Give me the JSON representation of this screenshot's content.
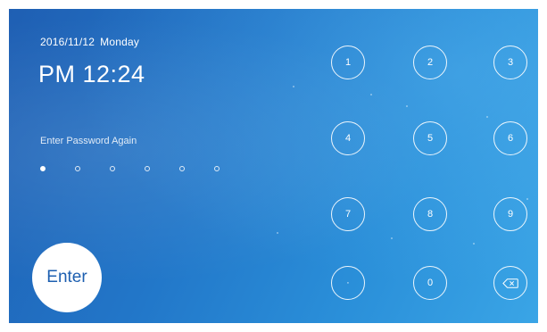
{
  "header": {
    "date": "2016/11/12",
    "weekday": "Monday",
    "time": "PM 12:24"
  },
  "password": {
    "prompt": "Enter Password Again",
    "length": 6,
    "entered": 1
  },
  "actions": {
    "enter_label": "Enter"
  },
  "keypad": {
    "keys": [
      "1",
      "2",
      "3",
      "4",
      "5",
      "6",
      "7",
      "8",
      "9",
      "·",
      "0"
    ],
    "backspace_icon": "backspace-icon"
  },
  "colors": {
    "background_start": "#1f5fb3",
    "background_end": "#3aa5e6",
    "enter_text": "#1d5fb0",
    "foreground": "#ffffff"
  }
}
